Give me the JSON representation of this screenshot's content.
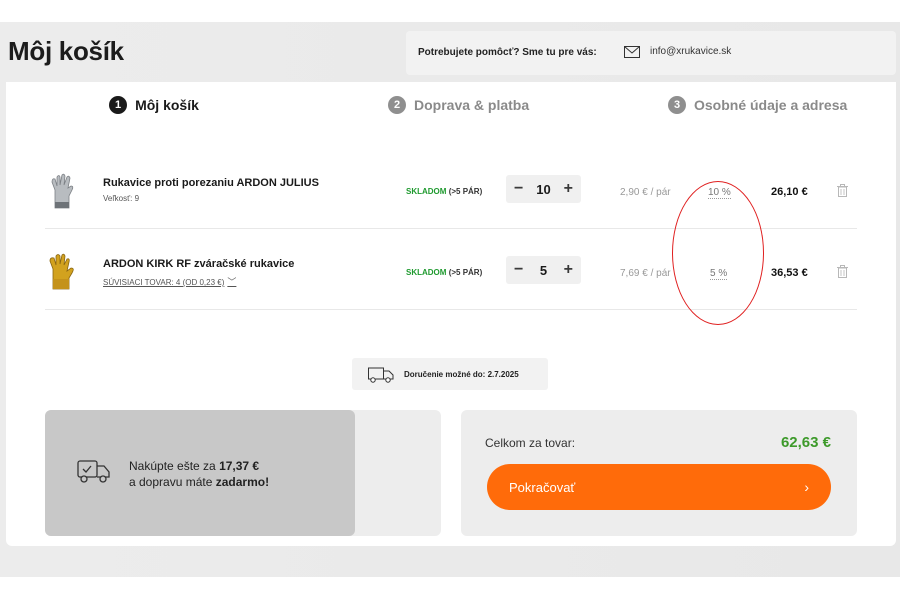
{
  "page": {
    "title": "Môj košík"
  },
  "help": {
    "text": "Potrebujete pomôcť? Sme tu pre vás:",
    "email": "info@xrukavice.sk",
    "mail_icon": "envelope-icon"
  },
  "tabs": [
    {
      "number": "1",
      "label": "Môj košík",
      "active": true
    },
    {
      "number": "2",
      "label": "Doprava & platba",
      "active": false
    },
    {
      "number": "3",
      "label": "Osobné údaje a adresa",
      "active": false
    }
  ],
  "items": [
    {
      "name": "Rukavice proti porezaniu ARDON JULIUS",
      "sub": "Veľkosť: 9",
      "stock": "SKLADOM",
      "stock_note": "(>5 PÁR)",
      "qty": "10",
      "unit_price": "2,90 € / pár",
      "discount": "10 %",
      "total": "26,10 €"
    },
    {
      "name": "ARDON KIRK RF zváračské rukavice",
      "sub": "SÚVISIACI TOVAR: 4 (OD 0,23 €)",
      "stock": "SKLADOM",
      "stock_note": "(>5 PÁR)",
      "qty": "5",
      "unit_price": "7,69 € / pár",
      "discount": "5 %",
      "total": "36,53 €"
    }
  ],
  "stepper": {
    "minus": "−",
    "plus": "+"
  },
  "delivery": {
    "text": "Doručenie možné do: 2.7.2025"
  },
  "free_shipping": {
    "line1_prefix": "Nakúpte ešte za ",
    "amount": "17,37 €",
    "line2_prefix": "a dopravu máte ",
    "line2_bold": "zadarmo!"
  },
  "summary": {
    "label": "Celkom za tovar:",
    "value": "62,63 €",
    "button": "Pokračovať",
    "button_arrow": "›"
  },
  "colors": {
    "accent": "#ff6b0a",
    "price_green": "#3d9a2a",
    "stock_green": "#1f9a2f",
    "annotation_red": "#e02020"
  }
}
